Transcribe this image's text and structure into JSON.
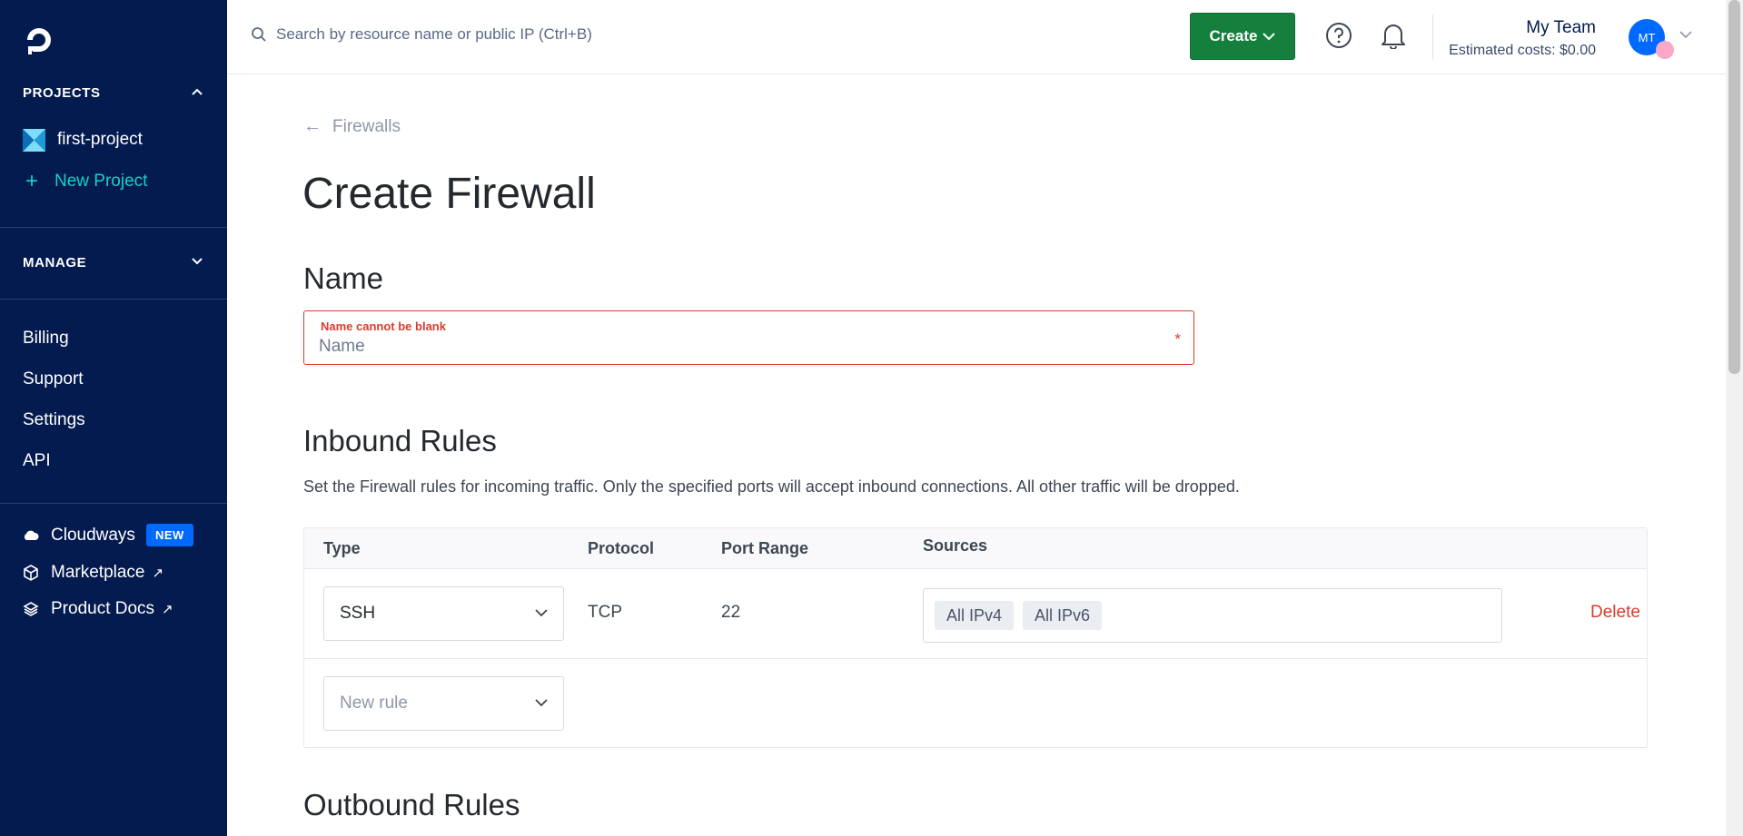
{
  "sidebar": {
    "projects_heading": "PROJECTS",
    "project_name": "first-project",
    "new_project_label": "New Project",
    "manage_heading": "MANAGE",
    "links": [
      "Billing",
      "Support",
      "Settings",
      "API"
    ],
    "cloudways_label": "Cloudways",
    "cloudways_badge": "NEW",
    "marketplace_label": "Marketplace",
    "docs_label": "Product Docs"
  },
  "topbar": {
    "search_placeholder": "Search by resource name or public IP (Ctrl+B)",
    "create_label": "Create",
    "team_name": "My Team",
    "estimated_costs": "Estimated costs: $0.00",
    "avatar_initials": "MT"
  },
  "page": {
    "back_label": "Firewalls",
    "title": "Create Firewall",
    "name_heading": "Name",
    "name_error": "Name cannot be blank",
    "name_placeholder": "Name",
    "name_required_mark": "*",
    "inbound_heading": "Inbound Rules",
    "inbound_description": "Set the Firewall rules for incoming traffic. Only the specified ports will accept inbound connections. All other traffic will be dropped.",
    "outbound_heading": "Outbound Rules"
  },
  "inbound": {
    "headers": {
      "type": "Type",
      "protocol": "Protocol",
      "port_range": "Port Range",
      "sources": "Sources"
    },
    "rule": {
      "type": "SSH",
      "protocol": "TCP",
      "port_range": "22",
      "sources": [
        "All IPv4",
        "All IPv6"
      ],
      "delete_label": "Delete"
    },
    "new_rule_placeholder": "New rule"
  },
  "colors": {
    "sidebar_bg": "#031b4e",
    "accent_teal": "#14d1c7",
    "create_green": "#15803d",
    "error_red": "#d93c2d",
    "brand_blue": "#0069ff"
  }
}
